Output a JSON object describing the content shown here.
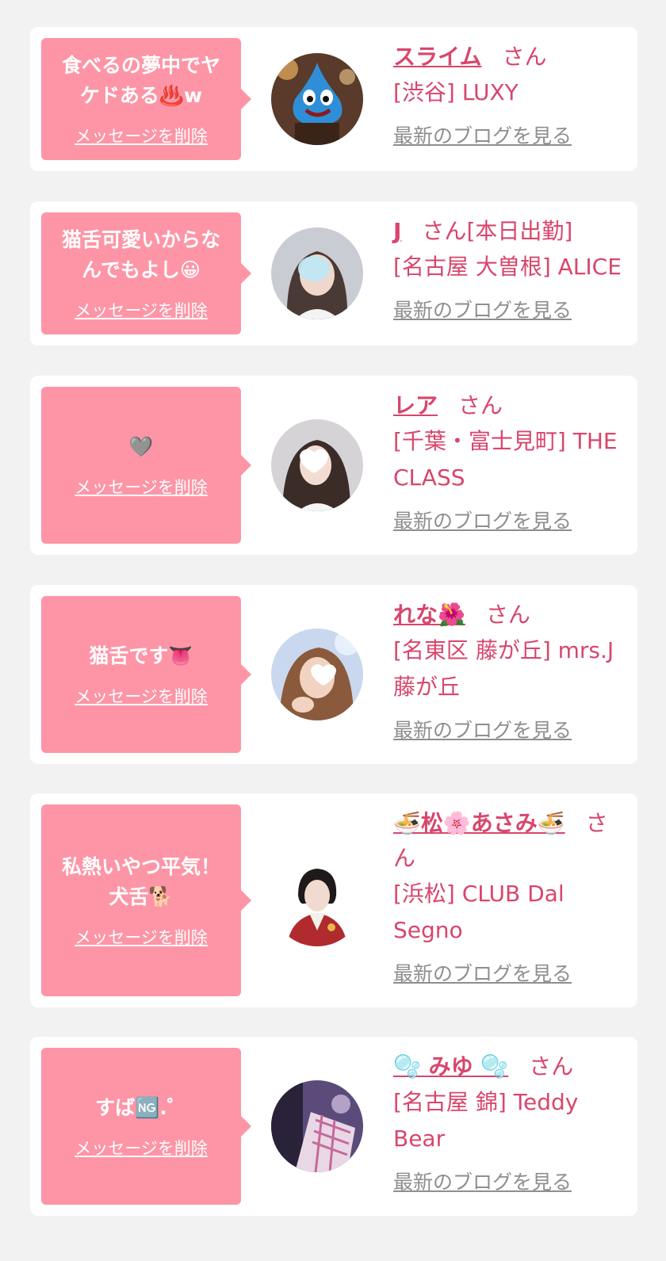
{
  "colors": {
    "bubble": "#fd95a6",
    "accent": "#d8466c",
    "link_gray": "#8e8e8e",
    "card": "#ffffff",
    "page_bg": "#f2f2f2"
  },
  "labels": {
    "delete": "メッセージを削除",
    "blog": "最新のブログを見る",
    "san": "さん"
  },
  "items": [
    {
      "message": "食べるの夢中でヤケドある♨️w",
      "name": "スライム",
      "status": "",
      "shop": "[渋谷] LUXY",
      "avatar": "slime-avatar"
    },
    {
      "message": "猫舌可愛いからなんでもよし😀",
      "name": "J",
      "status": "[本日出勤]",
      "shop": "[名古屋 大曽根] ALICE",
      "avatar": "girl-avatar"
    },
    {
      "message": "🩶",
      "name": "レア",
      "status": "",
      "shop": "[千葉・富士見町] THE CLASS",
      "avatar": "girl-avatar"
    },
    {
      "message": "猫舌です👅",
      "name": "れな🌺",
      "status": "",
      "shop": "[名東区 藤が丘] mrs.J 藤が丘",
      "avatar": "girl-avatar"
    },
    {
      "message": "私熱いやつ平気！犬舌🐕",
      "name": "🍜松🌸あさみ🍜",
      "status": "",
      "shop": "[浜松] CLUB Dal Segno",
      "avatar": "kimono-avatar"
    },
    {
      "message": "すば🆖.゜",
      "name": "🫧 みゆ 🫧",
      "status": "",
      "shop": "[名古屋 錦] Teddy Bear",
      "avatar": "girl-avatar"
    }
  ]
}
